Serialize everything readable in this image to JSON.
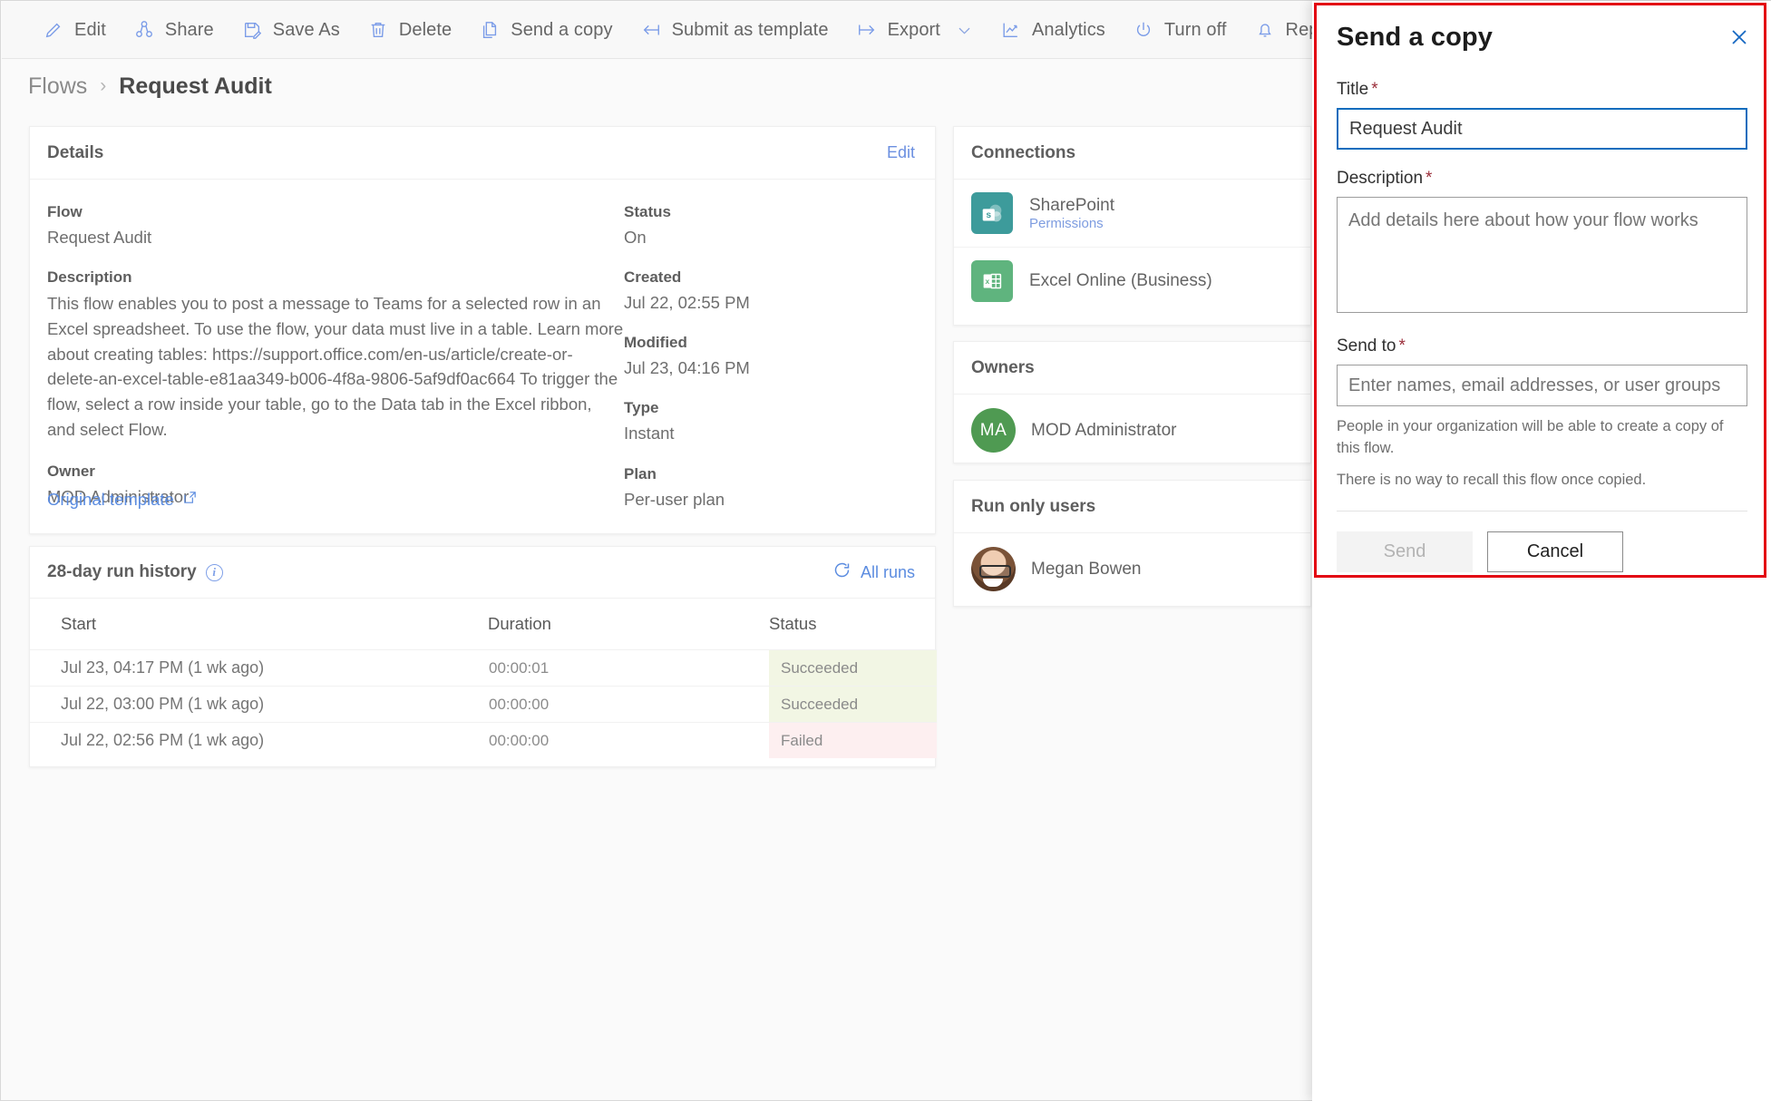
{
  "toolbar": {
    "items": [
      {
        "label": "Edit",
        "icon": "pencil-icon",
        "name": "edit"
      },
      {
        "label": "Share",
        "icon": "share-icon",
        "name": "share"
      },
      {
        "label": "Save As",
        "icon": "save-as-icon",
        "name": "save-as"
      },
      {
        "label": "Delete",
        "icon": "trash-icon",
        "name": "delete"
      },
      {
        "label": "Send a copy",
        "icon": "copy-icon",
        "name": "send-a-copy"
      },
      {
        "label": "Submit as template",
        "icon": "arrow-left-bar-icon",
        "name": "submit-as-template"
      },
      {
        "label": "Export",
        "icon": "arrow-right-bar-icon",
        "name": "export",
        "chevron": true
      },
      {
        "label": "Analytics",
        "icon": "line-chart-icon",
        "name": "analytics"
      },
      {
        "label": "Turn off",
        "icon": "power-icon",
        "name": "turn-off"
      },
      {
        "label": "Repair tip",
        "icon": "bell-icon",
        "name": "repair-tip"
      }
    ]
  },
  "breadcrumb": {
    "root": "Flows",
    "separator": "›",
    "current": "Request Audit"
  },
  "details": {
    "title": "Details",
    "edit_label": "Edit",
    "flow_label": "Flow",
    "flow_value": "Request Audit",
    "description_label": "Description",
    "description_value": "This flow enables you to post a message to Teams for a selected row in an Excel spreadsheet. To use the flow, your data must live in a table. Learn more about creating tables: https://support.office.com/en-us/article/create-or-delete-an-excel-table-e81aa349-b006-4f8a-9806-5af9df0ac664 To trigger the flow, select a row inside your table, go to the Data tab in the Excel ribbon, and select Flow.",
    "owner_label": "Owner",
    "owner_value": "MOD Administrator",
    "status_label": "Status",
    "status_value": "On",
    "created_label": "Created",
    "created_value": "Jul 22, 02:55 PM",
    "modified_label": "Modified",
    "modified_value": "Jul 23, 04:16 PM",
    "type_label": "Type",
    "type_value": "Instant",
    "plan_label": "Plan",
    "plan_value": "Per-user plan",
    "original_template_label": "Original template"
  },
  "run_history": {
    "title": "28-day run history",
    "all_runs_label": "All runs",
    "columns": [
      "Start",
      "Duration",
      "Status"
    ],
    "rows": [
      {
        "start": "Jul 23, 04:17 PM (1 wk ago)",
        "duration": "00:00:01",
        "status": "Succeeded",
        "state": "ok"
      },
      {
        "start": "Jul 22, 03:00 PM (1 wk ago)",
        "duration": "00:00:00",
        "status": "Succeeded",
        "state": "ok"
      },
      {
        "start": "Jul 22, 02:56 PM (1 wk ago)",
        "duration": "00:00:00",
        "status": "Failed",
        "state": "fail"
      }
    ]
  },
  "connections": {
    "title": "Connections",
    "items": [
      {
        "name": "SharePoint",
        "sub": "Permissions",
        "icon": "sharepoint-icon"
      },
      {
        "name": "Excel Online (Business)",
        "sub": "",
        "icon": "excel-icon"
      }
    ]
  },
  "owners": {
    "title": "Owners",
    "items": [
      {
        "initials": "MA",
        "name": "MOD Administrator"
      }
    ]
  },
  "run_only_users": {
    "title": "Run only users",
    "items": [
      {
        "name": "Megan Bowen"
      }
    ]
  },
  "dialog": {
    "title": "Send a copy",
    "close_icon": "close-icon",
    "title_field_label": "Title",
    "title_field_value": "Request Audit",
    "description_field_label": "Description",
    "description_field_placeholder": "Add details here about how your flow works",
    "description_field_value": "",
    "send_to_label": "Send to",
    "send_to_placeholder": "Enter names, email addresses, or user groups",
    "send_to_value": "",
    "required_marker": "*",
    "help_line_1": "People in your organization will be able to create a copy of this flow.",
    "help_line_2": "There is no way to recall this flow once copied.",
    "send_label": "Send",
    "cancel_label": "Cancel"
  },
  "colors": {
    "accent_blue": "#0f6cbd",
    "icon_blue": "#7b9ce8",
    "highlight_red": "#e30613",
    "success_bg": "#f2f6e4",
    "fail_bg": "#fdeff0",
    "sharepoint_teal": "#3d9b9b",
    "excel_green": "#5fb47e",
    "avatar_green": "#4f9a52"
  }
}
